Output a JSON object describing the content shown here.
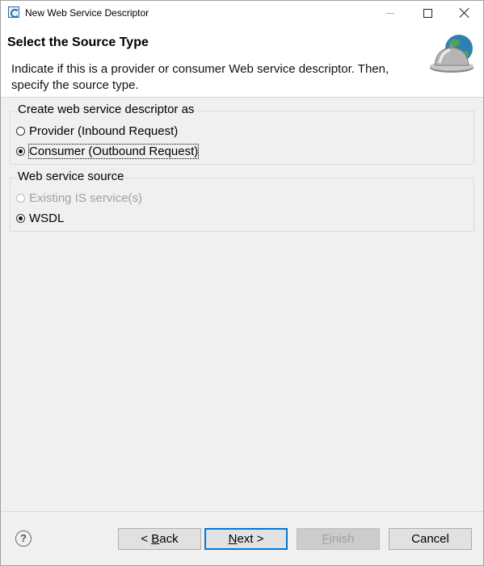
{
  "window": {
    "title": "New Web Service Descriptor",
    "controls": [
      "minimize-icon",
      "maximize-icon",
      "close-icon"
    ]
  },
  "header": {
    "title": "Select the Source Type",
    "description": "Indicate if this is a provider or consumer Web service descriptor. Then, specify the source type.",
    "banner_icon": "globe-service-bell-icon"
  },
  "descriptor_group": {
    "legend": "Create web service descriptor as",
    "options": [
      {
        "label": "Provider (Inbound Request)",
        "checked": false,
        "enabled": true
      },
      {
        "label": "Consumer (Outbound Request)",
        "checked": true,
        "enabled": true
      }
    ]
  },
  "source_group": {
    "legend": "Web service source",
    "options": [
      {
        "label": "Existing IS service(s)",
        "checked": false,
        "enabled": false
      },
      {
        "label": "WSDL",
        "checked": true,
        "enabled": true
      }
    ]
  },
  "footer": {
    "help_icon": "help-icon",
    "back": {
      "mnemonic": "B",
      "rest": "ack",
      "prefix": "< "
    },
    "next": {
      "mnemonic": "N",
      "rest": "ext",
      "suffix": " >"
    },
    "finish": {
      "mnemonic": "F",
      "rest": "inish"
    },
    "cancel": {
      "label": "Cancel"
    }
  }
}
